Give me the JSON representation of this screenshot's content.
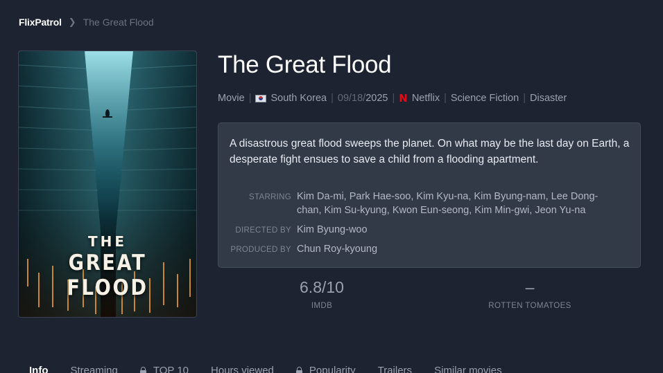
{
  "breadcrumb": {
    "brand": "FlixPatrol",
    "separator": ">",
    "current": "The Great Flood"
  },
  "poster": {
    "title_line1": "THE",
    "title_line2": "GREAT FLOOD"
  },
  "movie": {
    "title": "The Great Flood",
    "meta": {
      "type": "Movie",
      "country": "South Korea",
      "date_md": "09/18/",
      "date_year": "2025",
      "platform": "Netflix",
      "genre1": "Science Fiction",
      "genre2": "Disaster"
    },
    "description": "A disastrous great flood sweeps the planet. On what may be the last day on Earth, a desperate fight ensues to save a child from a flooding apartment.",
    "credits": {
      "starring_label": "STARRING",
      "starring": "Kim Da-mi, Park Hae-soo, Kim Kyu-na, Kim Byung-nam, Lee Dong-chan, Kim Su-kyung, Kwon Eun-seong, Kim Min-gwi, Jeon Yu-na",
      "directed_label": "DIRECTED BY",
      "directed": "Kim Byung-woo",
      "produced_label": "PRODUCED BY",
      "produced": "Chun Roy-kyoung"
    },
    "ratings": {
      "imdb_value": "6.8/10",
      "imdb_label": "IMDB",
      "rt_value": "–",
      "rt_label": "ROTTEN TOMATOES"
    }
  },
  "tabs": {
    "info": "Info",
    "streaming": "Streaming",
    "top10": "TOP 10",
    "hours": "Hours viewed",
    "popularity": "Popularity",
    "trailers": "Trailers",
    "similar": "Similar movies"
  },
  "colors": {
    "background": "#1d2330",
    "card": "#323947",
    "netflix_red": "#e50914"
  }
}
